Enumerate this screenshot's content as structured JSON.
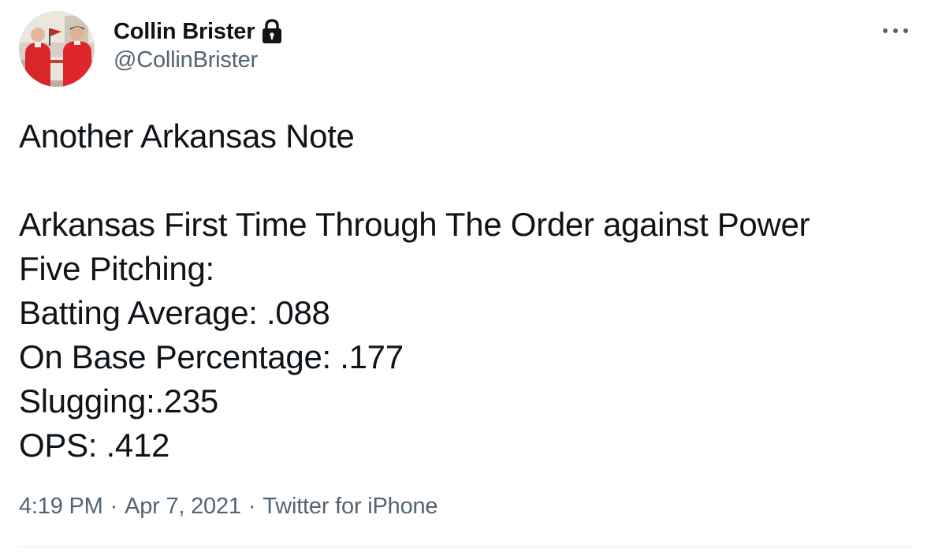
{
  "author": {
    "display_name": "Collin Brister",
    "handle": "@CollinBrister",
    "protected_icon": "lock-icon"
  },
  "header": {
    "more_icon": "more-horizontal-icon"
  },
  "tweet": {
    "lines": [
      "Another Arkansas Note",
      "",
      "Arkansas First Time Through The Order against Power",
      "Five Pitching:",
      "Batting Average: .088",
      "On Base Percentage: .177",
      "Slugging:.235",
      "OPS: .412"
    ]
  },
  "meta": {
    "time": "4:19 PM",
    "separator": "·",
    "date": "Apr 7, 2021",
    "source": "Twitter for iPhone"
  },
  "colors": {
    "text_primary": "#0f1419",
    "text_secondary": "#536471",
    "divider": "#e6ecf0",
    "avatar_shirt": "#d9262b"
  }
}
